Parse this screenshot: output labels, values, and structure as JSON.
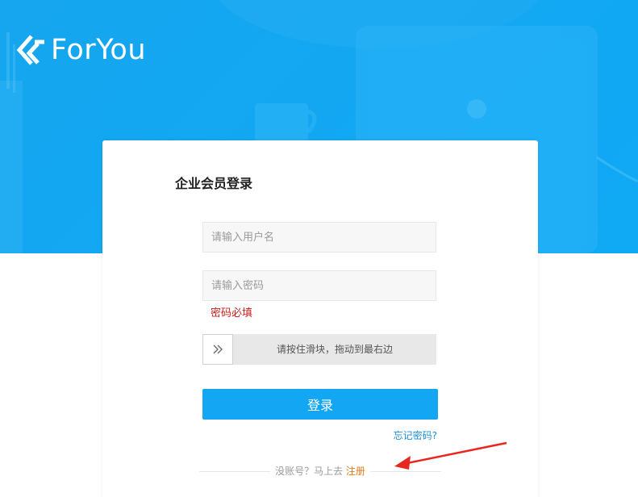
{
  "brand": {
    "name": "ForYou"
  },
  "login": {
    "title": "企业会员登录",
    "username_placeholder": "请输入用户名",
    "password_placeholder": "请输入密码",
    "password_error": "密码必填",
    "slider_text": "请按住滑块，拖动到最右边",
    "slider_handle_icon": "double-chevron-right-icon",
    "submit_label": "登录",
    "forgot_label": "忘记密码?",
    "no_account_text": "没账号？马上去",
    "register_label": "注册"
  },
  "colors": {
    "hero": "#13a7f2",
    "primary_button": "#13a6f3",
    "error": "#c8211b",
    "register_link": "#e07b1a",
    "forgot_link": "#1a8fd8",
    "annotation_arrow": "#e8281e"
  }
}
